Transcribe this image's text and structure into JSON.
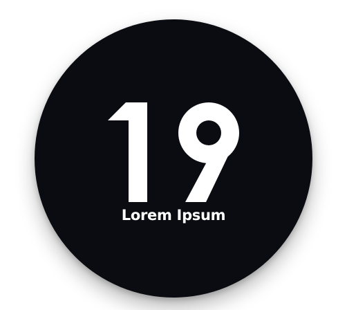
{
  "badge": {
    "number": "19",
    "caption": "Lorem Ipsum",
    "background_color": "#0b0c11",
    "text_color": "#ffffff"
  }
}
